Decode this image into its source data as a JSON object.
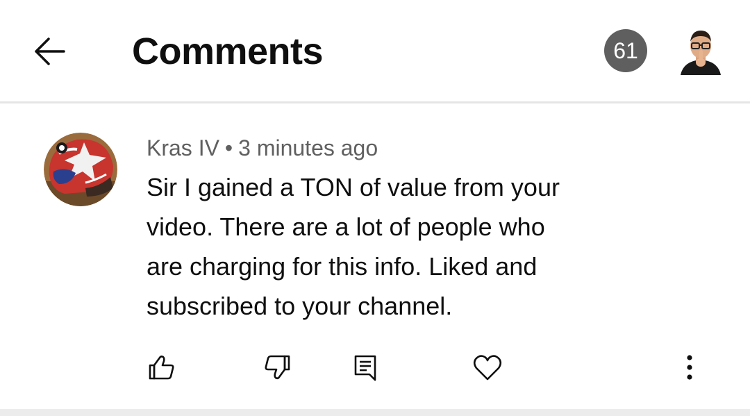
{
  "header": {
    "back_icon": "arrow-left-icon",
    "title": "Comments",
    "count": "61",
    "account_avatar": "user-avatar"
  },
  "comment": {
    "author": "Kras IV",
    "separator": "•",
    "time": "3 minutes ago",
    "text": "Sir I gained a TON of value from your\nvideo.  There are a lot of people who\nare charging for this info.  Liked and\nsubscribed to your channel.",
    "actions": [
      "thumbs-up-icon",
      "thumbs-down-icon",
      "reply-icon",
      "heart-icon",
      "more-vert-icon"
    ]
  },
  "colors": {
    "badge": "#5f5f5f",
    "meta_text": "#606060",
    "divider": "#e5e5e5"
  }
}
